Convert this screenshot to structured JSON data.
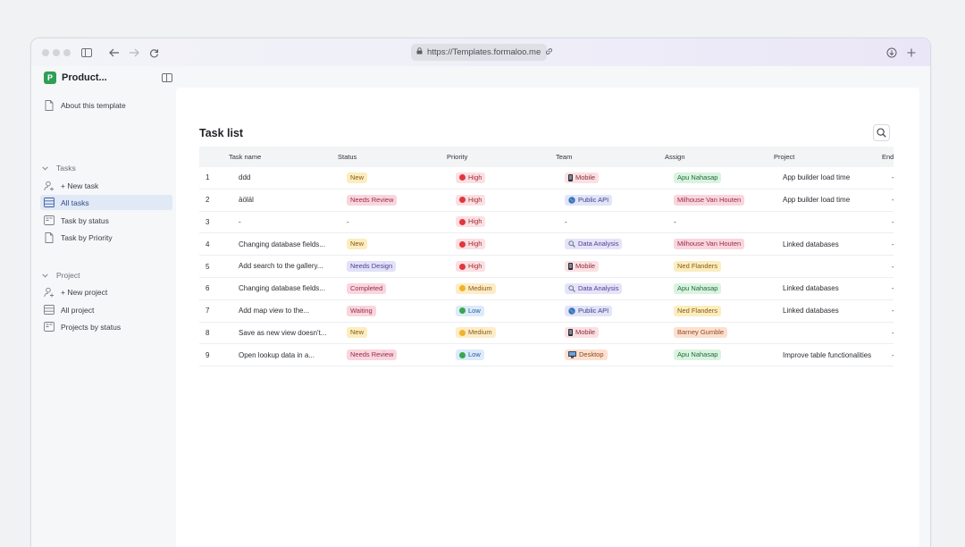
{
  "browser": {
    "url": "https://Templates.formaloo.me"
  },
  "sidebar": {
    "app_logo_letter": "P",
    "app_name": "Product...",
    "about": "About this template",
    "tasks_section": "Tasks",
    "new_task": "+ New task",
    "all_tasks": "All tasks",
    "task_by_status": "Task by status",
    "task_by_priority": "Task by Priority",
    "project_section": "Project",
    "new_project": "+ New project",
    "all_project": "All project",
    "projects_by_status": "Projects by status"
  },
  "main": {
    "title": "Task list",
    "columns": [
      "Task name",
      "Status",
      "Priority",
      "Team",
      "Assign",
      "Project",
      "End"
    ],
    "rows": [
      {
        "num": "1",
        "task": "ddd",
        "status": "New",
        "status_color": "yellow",
        "priority": "High",
        "priority_color": "#e5343b",
        "team": "Mobile",
        "team_icon": "phone",
        "assign": "Apu Nahasap",
        "assign_color": "green",
        "project": "App builder load time",
        "end": "-"
      },
      {
        "num": "2",
        "task": "äöläl",
        "status": "Needs Review",
        "status_color": "pink",
        "priority": "High",
        "priority_color": "#e5343b",
        "team": "Public API",
        "team_icon": "globe",
        "assign": "Milhouse Van Houten",
        "assign_color": "pink",
        "project": "App builder load time",
        "end": "-"
      },
      {
        "num": "3",
        "task": "-",
        "status": "-",
        "status_color": "none",
        "priority": "High",
        "priority_color": "#e5343b",
        "team": "-",
        "team_icon": "none",
        "assign": "-",
        "assign_color": "none",
        "project": "",
        "end": "-"
      },
      {
        "num": "4",
        "task": "Changing database fields...",
        "status": "New",
        "status_color": "yellow",
        "priority": "High",
        "priority_color": "#e5343b",
        "team": "Data Analysis",
        "team_icon": "magnifier",
        "assign": "Milhouse Van Houten",
        "assign_color": "pink",
        "project": "Linked databases",
        "end": "-"
      },
      {
        "num": "5",
        "task": "Add search to the gallery...",
        "status": "Needs Design",
        "status_color": "purple",
        "priority": "High",
        "priority_color": "#e5343b",
        "team": "Mobile",
        "team_icon": "phone",
        "assign": "Ned Flanders",
        "assign_color": "yellow",
        "project": "",
        "end": "-"
      },
      {
        "num": "6",
        "task": "Changing database fields...",
        "status": "Completed",
        "status_color": "pink",
        "priority": "Medium",
        "priority_color": "#f2b227",
        "team": "Data Analysis",
        "team_icon": "magnifier",
        "assign": "Apu Nahasap",
        "assign_color": "green",
        "project": "Linked databases",
        "end": "-"
      },
      {
        "num": "7",
        "task": "Add map view to the...",
        "status": "Waiting",
        "status_color": "pink",
        "priority": "Low",
        "priority_color": "#3aa64a",
        "team": "Public API",
        "team_icon": "globe",
        "assign": "Ned Flanders",
        "assign_color": "yellow",
        "project": "Linked databases",
        "end": "-"
      },
      {
        "num": "8",
        "task": "Save as new view doesn't...",
        "status": "New",
        "status_color": "yellow",
        "priority": "Medium",
        "priority_color": "#f2b227",
        "team": "Mobile",
        "team_icon": "phone",
        "assign": "Barney Gumble",
        "assign_color": "orange",
        "project": "",
        "end": "-"
      },
      {
        "num": "9",
        "task": "Open lookup data in a...",
        "status": "Needs Review",
        "status_color": "pink",
        "priority": "Low",
        "priority_color": "#3aa64a",
        "team": "Desktop",
        "team_icon": "monitor",
        "assign": "Apu Nahasap",
        "assign_color": "green",
        "project": "Improve table functionalities",
        "end": "-"
      }
    ]
  },
  "palette": {
    "yellow": {
      "bg": "#fbedbf",
      "fg": "#8a5a10"
    },
    "pink": {
      "bg": "#f9d6de",
      "fg": "#9b2849"
    },
    "purple": {
      "bg": "#e3e1f7",
      "fg": "#4a3f99"
    },
    "green": {
      "bg": "#d9f3e0",
      "fg": "#1f6b38"
    },
    "orange": {
      "bg": "#fbe0d0",
      "fg": "#9a4a1c"
    },
    "priority_bg": "#fbe0e3",
    "priority_fg": "#a42a35",
    "priority_bg_medium": "#fdecc8",
    "priority_fg_medium": "#8a5a10",
    "priority_bg_low": "#dcebfb",
    "priority_fg_low": "#2a5a9a",
    "team_bg_mobile": "#fbe0e3",
    "team_fg_mobile": "#8b2a35",
    "team_bg_api": "#e3e4f8",
    "team_fg_api": "#3a3f8c",
    "team_bg_data": "#e6e3f8",
    "team_fg_data": "#4a3f99",
    "team_bg_desktop": "#fde0cf",
    "team_fg_desktop": "#8a4a1c"
  }
}
